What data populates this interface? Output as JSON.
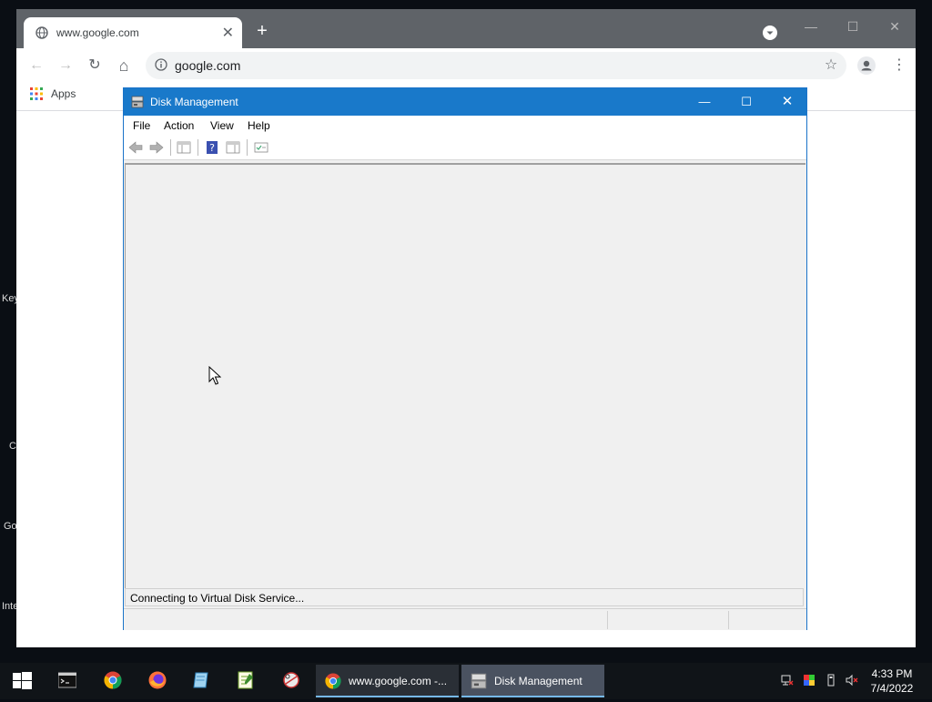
{
  "desktop": {
    "labels": [
      "Key",
      "C",
      "Go",
      "Inte"
    ]
  },
  "chrome": {
    "tab": {
      "title": "www.google.com",
      "close_glyph": "✕"
    },
    "new_tab_glyph": "+",
    "window_controls": {
      "minimize": "—",
      "maximize": "☐",
      "close": "✕"
    },
    "toolbar": {
      "back": "←",
      "forward": "→",
      "reload": "↻",
      "home": "⌂",
      "url": "google.com",
      "star": "☆",
      "menu": "⋮"
    },
    "bookmarks": {
      "apps_label": "Apps"
    }
  },
  "disk_management": {
    "title": "Disk Management",
    "window_controls": {
      "minimize": "—",
      "maximize": "☐",
      "close": "✕"
    },
    "menu": [
      "File",
      "Action",
      "View",
      "Help"
    ],
    "progress_text": "Connecting to Virtual Disk Service...",
    "colors": {
      "titlebar": "#1979ca"
    }
  },
  "taskbar": {
    "windows": [
      {
        "label": "www.google.com -..."
      },
      {
        "label": "Disk Management"
      }
    ],
    "clock": {
      "time": "4:33 PM",
      "date": "7/4/2022"
    }
  }
}
